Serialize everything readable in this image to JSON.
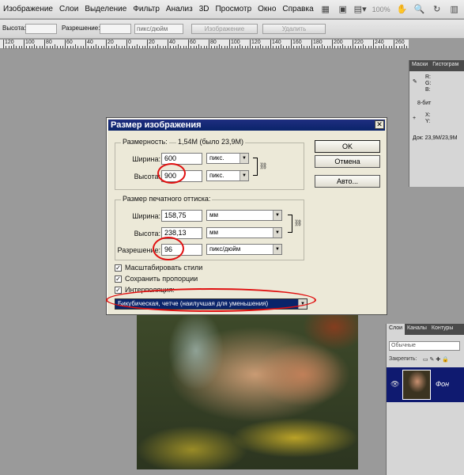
{
  "menubar": {
    "items": [
      "Изображение",
      "Слои",
      "Выделение",
      "Фильтр",
      "Анализ",
      "3D",
      "Просмотр",
      "Окно",
      "Справка"
    ],
    "zoom": "100%"
  },
  "optionsbar": {
    "height_label": "Высота:",
    "resolution_label": "Разрешение:",
    "unit_value": "пикс/дюйм",
    "image_button": "Изображение",
    "delete_button": "Удалить"
  },
  "ruler": {
    "labels": [
      "120",
      "100",
      "80",
      "60",
      "40",
      "20",
      "0",
      "20",
      "40",
      "60",
      "80",
      "100",
      "120",
      "140",
      "160",
      "180",
      "200",
      "220",
      "240",
      "260"
    ]
  },
  "info_panel": {
    "tabs": [
      "Маски",
      "Гистограм"
    ],
    "rgb": [
      "R:",
      "G:",
      "B:"
    ],
    "bits": "8-бит",
    "xy": [
      "X:",
      "Y:"
    ],
    "doc": "Док: 23,9M/23,9M"
  },
  "layers_panel": {
    "tabs": [
      "Слои",
      "Каналы",
      "Контуры"
    ],
    "blend_mode": "Обычные",
    "lock_label": "Закрепить:",
    "layer_name": "Фон"
  },
  "dialog": {
    "title": "Размер изображения",
    "pixel_dimensions": {
      "label": "Размерность:",
      "value": "1,54M (было 23,9M)",
      "width_label": "Ширина:",
      "width_value": "600",
      "width_unit": "пикс.",
      "height_label": "Высота:",
      "height_value": "900",
      "height_unit": "пикс."
    },
    "document_size": {
      "label": "Размер печатного оттиска:",
      "width_label": "Ширина:",
      "width_value": "158,75",
      "width_unit": "мм",
      "height_label": "Высота:",
      "height_value": "238,13",
      "height_unit": "мм",
      "resolution_label": "Разрешение:",
      "resolution_value": "96",
      "resolution_unit": "пикс/дюйм"
    },
    "checkboxes": [
      {
        "label": "Масштабировать стили",
        "checked": true
      },
      {
        "label": "Сохранить пропорции",
        "checked": true
      },
      {
        "label": "Интерполяция:",
        "checked": true
      }
    ],
    "interpolation_value": "Бикубическая, четче (наилучшая для уменьшения)",
    "ok_button": "OK",
    "cancel_button": "Отмена",
    "auto_button": "Авто..."
  }
}
